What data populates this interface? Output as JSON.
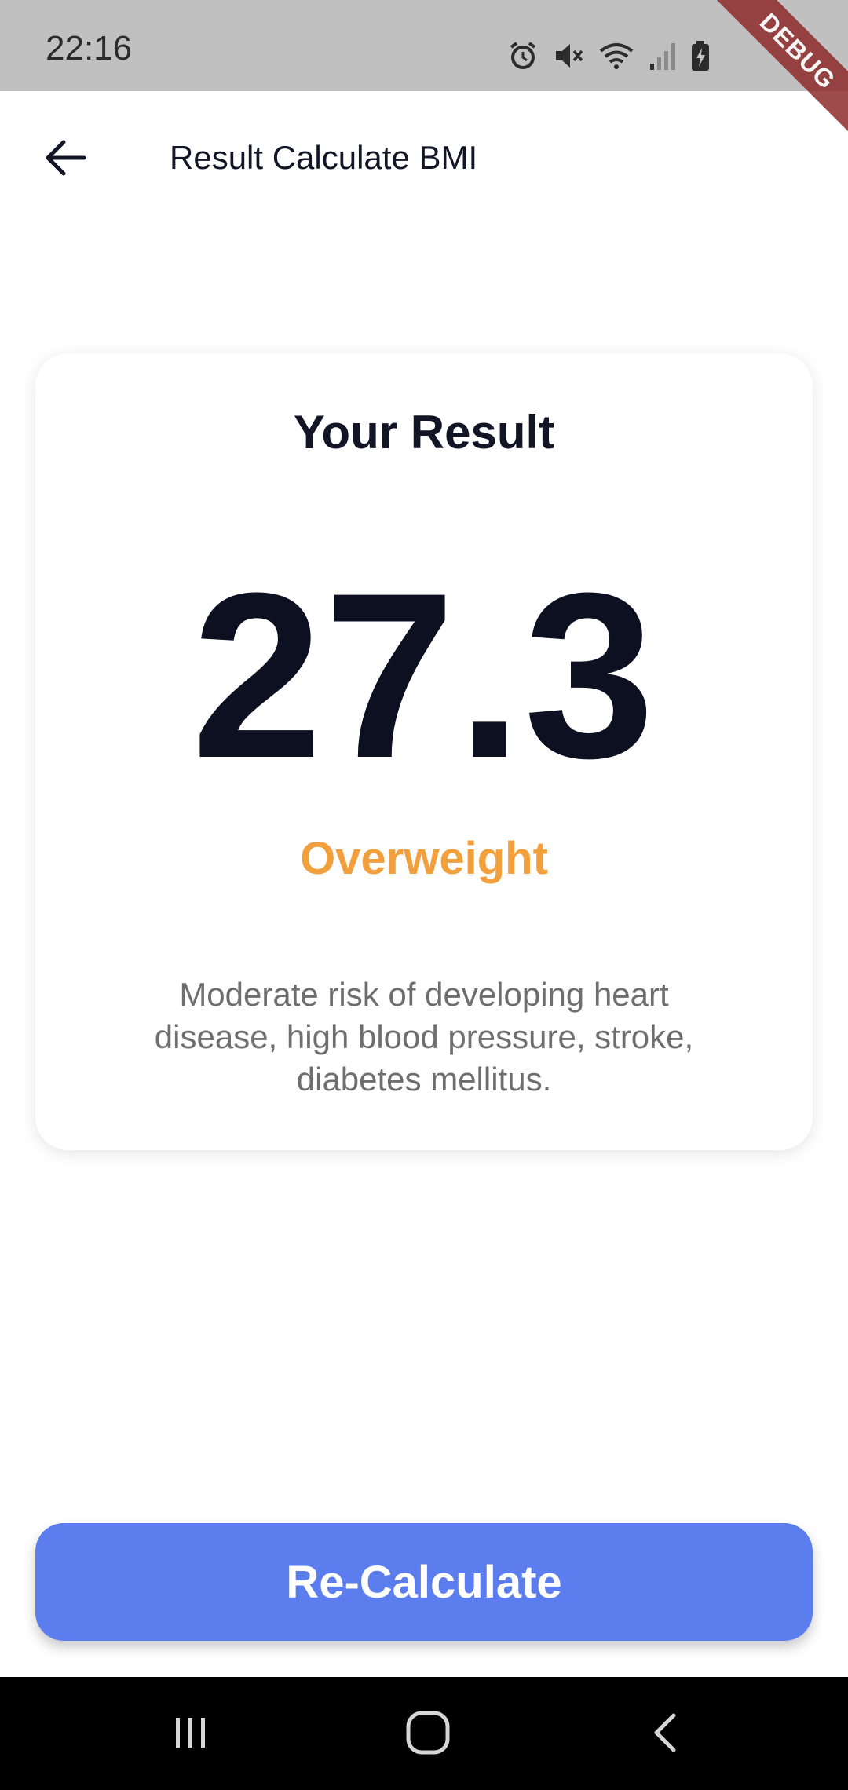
{
  "status_bar": {
    "time": "22:16",
    "icons": [
      "alarm-icon",
      "mute-icon",
      "wifi-icon",
      "signal-icon",
      "battery-charging-icon"
    ]
  },
  "debug_banner": "DEBUG",
  "app_bar": {
    "back_icon": "arrow-left-icon",
    "title": "Result Calculate BMI"
  },
  "result_card": {
    "heading": "Your Result",
    "bmi_value": "27.3",
    "category": "Overweight",
    "description": "Moderate risk of developing heart disease, high blood pressure, stroke, diabetes mellitus."
  },
  "action": {
    "recalculate_label": "Re-Calculate"
  },
  "nav_bar": {
    "icons": [
      "recent-apps-icon",
      "home-icon",
      "back-icon"
    ]
  },
  "colors": {
    "accent": "#5b7ded",
    "category": "#f2a03d",
    "text_dark": "#111526",
    "text_muted": "#6e6e6e",
    "status_bar": "#c0c0c0",
    "debug_banner": "#8e2c2c"
  }
}
